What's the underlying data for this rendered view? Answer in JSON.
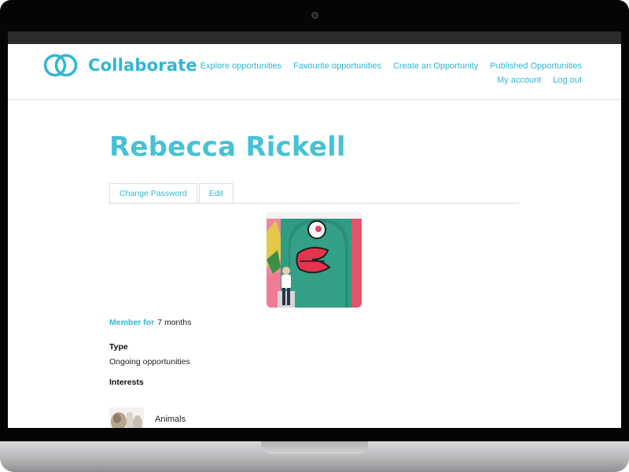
{
  "brand": {
    "name": "Collaborate",
    "accent_color": "#2fb8d0",
    "logo_icon": "two-rings-logo-icon"
  },
  "nav": {
    "row1": [
      "Explore opportunities",
      "Favourite opportunities",
      "Create an Opportunity",
      "Published Opportunities"
    ],
    "row2": [
      "My account",
      "Log out"
    ]
  },
  "profile": {
    "name": "Rebecca Rickell",
    "tabs": [
      "Change Password",
      "Edit"
    ],
    "avatar_icon": "profile-photo",
    "member_for_label": "Member for",
    "member_for_value": "7 months",
    "type_label": "Type",
    "type_value": "Ongoing opportunities",
    "interests_label": "Interests",
    "interests": [
      "Animals"
    ]
  }
}
